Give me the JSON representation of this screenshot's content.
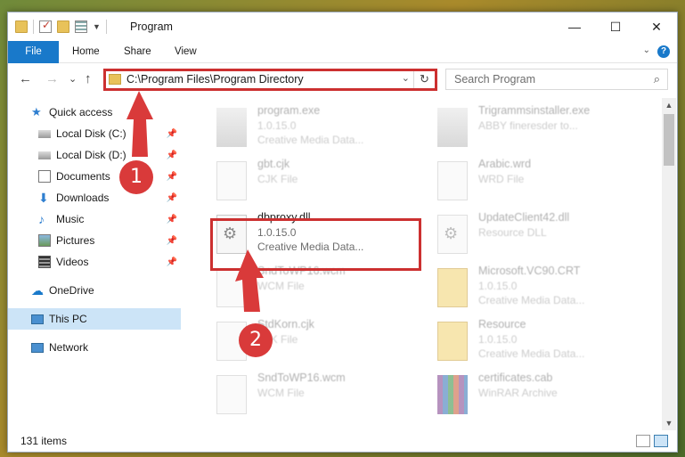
{
  "window": {
    "title": "Program",
    "controls": {
      "minimize": "—",
      "maximize": "☐",
      "close": "✕"
    }
  },
  "ribbon": {
    "tabs": [
      "File",
      "Home",
      "Share",
      "View"
    ],
    "help": "?"
  },
  "address_bar": {
    "path": "C:\\Program Files\\Program Directory",
    "dropdown": "⌄",
    "refresh": "↻"
  },
  "search": {
    "placeholder": "Search Program",
    "icon": "⌕"
  },
  "nav_buttons": {
    "back": "←",
    "forward": "→",
    "recent": "⌄",
    "up": "↑"
  },
  "sidebar": {
    "items": [
      {
        "label": "Quick access",
        "icon": "star-icon",
        "pinned": false
      },
      {
        "label": "Local Disk (C:)",
        "icon": "drive-icon",
        "pinned": true
      },
      {
        "label": "Local Disk (D:)",
        "icon": "drive-icon",
        "pinned": true
      },
      {
        "label": "Documents",
        "icon": "documents-icon",
        "pinned": true
      },
      {
        "label": "Downloads",
        "icon": "downloads-icon",
        "pinned": true
      },
      {
        "label": "Music",
        "icon": "music-icon",
        "pinned": true
      },
      {
        "label": "Pictures",
        "icon": "pictures-icon",
        "pinned": true
      },
      {
        "label": "Videos",
        "icon": "videos-icon",
        "pinned": true
      },
      {
        "label": "OneDrive",
        "icon": "cloud-icon",
        "pinned": false
      },
      {
        "label": "This PC",
        "icon": "computer-icon",
        "pinned": false,
        "selected": true
      },
      {
        "label": "Network",
        "icon": "network-icon",
        "pinned": false
      }
    ]
  },
  "files": [
    {
      "name": "program.exe",
      "line2": "1.0.15.0",
      "line3": "Creative Media Data...",
      "icon": "exe",
      "faded": true
    },
    {
      "name": "Trigrammsinstaller.exe",
      "line2": "ABBY fineresder to...",
      "line3": "",
      "icon": "exe",
      "faded": true
    },
    {
      "name": "gbt.cjk",
      "line2": "CJK File",
      "line3": "",
      "icon": "file",
      "faded": true
    },
    {
      "name": "Arabic.wrd",
      "line2": "WRD File",
      "line3": "",
      "icon": "file",
      "faded": true
    },
    {
      "name": "dbproxy.dll",
      "line2": "1.0.15.0",
      "line3": "Creative Media Data...",
      "icon": "gear",
      "faded": false
    },
    {
      "name": "UpdateClient42.dll",
      "line2": "Resource DLL",
      "line3": "",
      "icon": "gear",
      "faded": true
    },
    {
      "name": "SndToWP16.wcm",
      "line2": "WCM File",
      "line3": "",
      "icon": "file",
      "faded": true
    },
    {
      "name": "Microsoft.VC90.CRT",
      "line2": "1.0.15.0",
      "line3": "Creative Media Data...",
      "icon": "folder",
      "faded": true
    },
    {
      "name": "StdKorn.cjk",
      "line2": "CJK File",
      "line3": "",
      "icon": "file",
      "faded": true
    },
    {
      "name": "Resource",
      "line2": "1.0.15.0",
      "line3": "Creative Media Data...",
      "icon": "folder",
      "faded": true
    },
    {
      "name": "SndToWP16.wcm",
      "line2": "WCM File",
      "line3": "",
      "icon": "file",
      "faded": true
    },
    {
      "name": "certificates.cab",
      "line2": "WinRAR Archive",
      "line3": "",
      "icon": "cab",
      "faded": true
    }
  ],
  "status": {
    "items_count": "131 items"
  },
  "markers": {
    "one": "1",
    "two": "2"
  },
  "colors": {
    "accent": "#1979ca",
    "highlight": "#cc3030",
    "marker": "#d93a3a",
    "selected": "#cce4f7"
  }
}
